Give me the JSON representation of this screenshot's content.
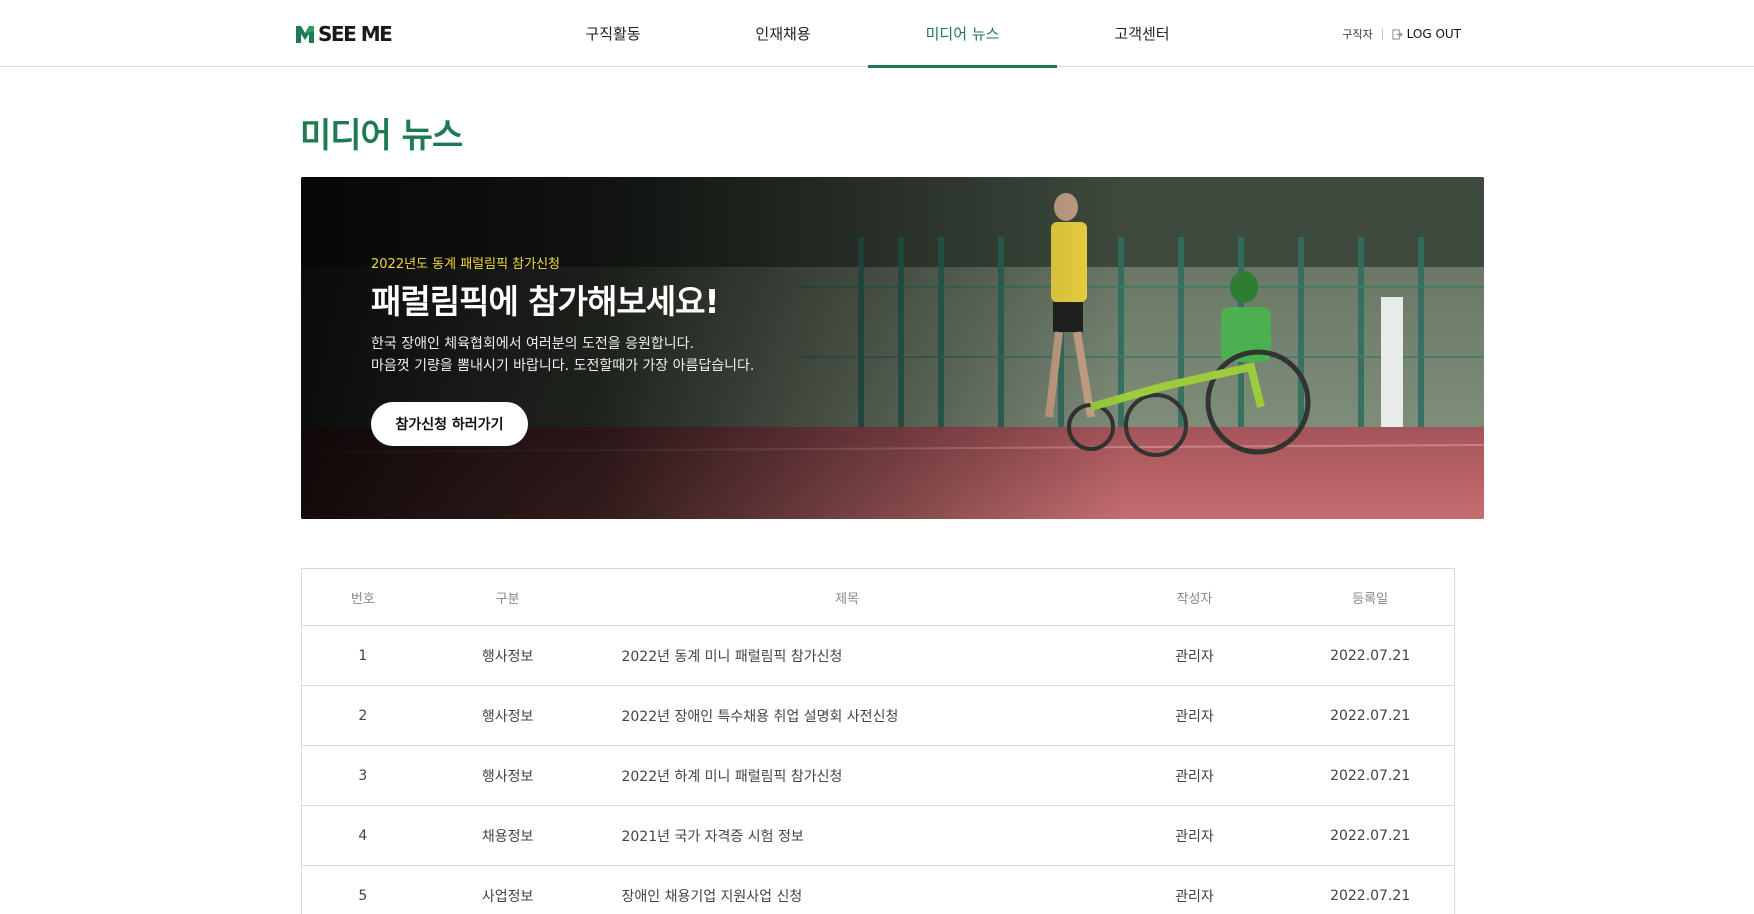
{
  "header": {
    "logo_text": "SEE ME",
    "nav": [
      {
        "label": "구직활동"
      },
      {
        "label": "인재채용"
      },
      {
        "label": "미디어 뉴스",
        "active": true
      },
      {
        "label": "고객센터"
      }
    ],
    "user_role": "구직자",
    "logout_label": "LOG OUT"
  },
  "page": {
    "title": "미디어 뉴스"
  },
  "banner": {
    "eyebrow": "2022년도 동계 패럴림픽 참가신청",
    "headline": "패럴림픽에 참가해보세요!",
    "desc_line1": "한국 장애인 체육협회에서 여러분의 도전을 응원합니다.",
    "desc_line2": "마음껏 기량을 뽐내시기 바랍니다. 도전할때가 가장 아름답습니다.",
    "button_label": "참가신청 하러가기"
  },
  "board": {
    "headers": {
      "no": "번호",
      "category": "구분",
      "title": "제목",
      "author": "작성자",
      "date": "등록일"
    },
    "rows": [
      {
        "no": "1",
        "category": "행사정보",
        "title": "2022년 동계 미니 패럴림픽 참가신청",
        "author": "관리자",
        "date": "2022.07.21"
      },
      {
        "no": "2",
        "category": "행사정보",
        "title": "2022년 장애인 특수채용 취업 설명회 사전신청",
        "author": "관리자",
        "date": "2022.07.21"
      },
      {
        "no": "3",
        "category": "행사정보",
        "title": "2022년 하계 미니 패럴림픽 참가신청",
        "author": "관리자",
        "date": "2022.07.21"
      },
      {
        "no": "4",
        "category": "채용정보",
        "title": "2021년 국가 자격증 시험 정보",
        "author": "관리자",
        "date": "2022.07.21"
      },
      {
        "no": "5",
        "category": "사업정보",
        "title": "장애인 채용기업 지원사업 신청",
        "author": "관리자",
        "date": "2022.07.21"
      }
    ]
  },
  "colors": {
    "brand_green": "#1e7a50",
    "eyebrow_yellow": "#f5d845"
  }
}
